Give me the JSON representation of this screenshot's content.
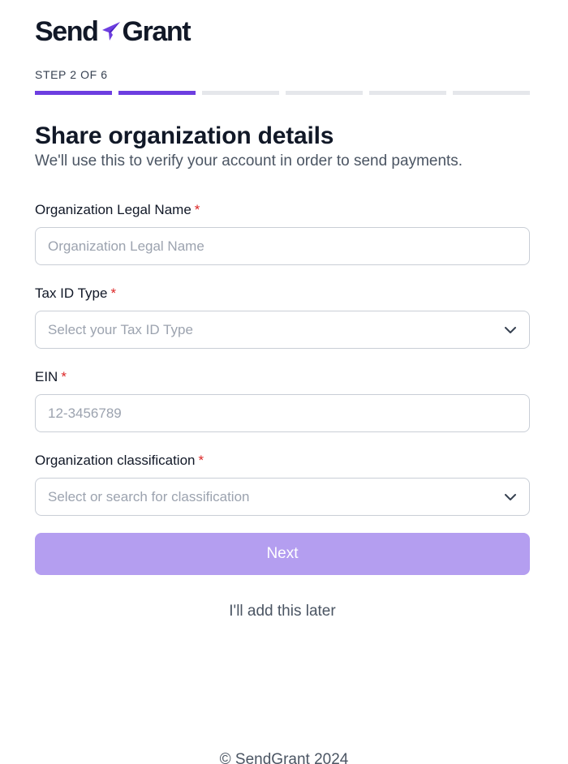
{
  "brand": {
    "name_left": "Send",
    "name_right": "Grant",
    "logo_icon": "paper-plane-icon",
    "accent_color": "#6d3ee0"
  },
  "progress": {
    "label": "STEP 2 OF 6",
    "current_step": 2,
    "total_steps": 6
  },
  "header": {
    "title": "Share organization details",
    "subtitle": "We'll use this to verify your account in order to send payments."
  },
  "form": {
    "required_marker": "*",
    "fields": [
      {
        "label": "Organization Legal Name",
        "placeholder": "Organization Legal Name",
        "type": "text"
      },
      {
        "label": "Tax ID Type",
        "placeholder": "Select your Tax ID Type",
        "type": "select",
        "icon": "chevron-down-icon"
      },
      {
        "label": "EIN",
        "placeholder": "12-3456789",
        "type": "text"
      },
      {
        "label": "Organization classification",
        "placeholder": "Select or search for classification",
        "type": "select",
        "icon": "chevron-down-icon"
      }
    ]
  },
  "actions": {
    "next_label": "Next",
    "next_color": "#b49ef0",
    "later_label": "I'll add this later"
  },
  "footer": {
    "copyright": "© SendGrant 2024"
  }
}
